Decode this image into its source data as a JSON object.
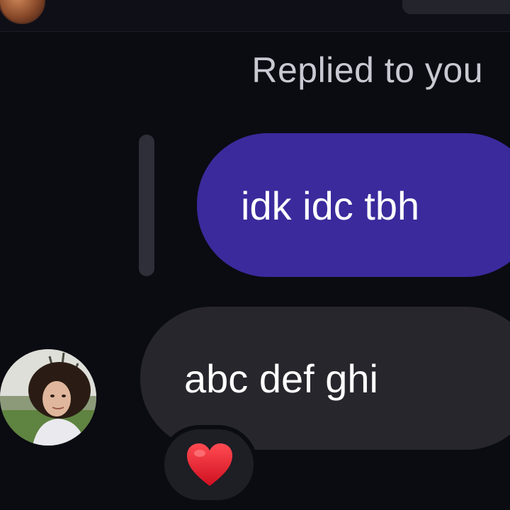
{
  "header": {
    "avatar_icon": "profile-avatar-icon"
  },
  "thread": {
    "reply_label": "Replied to you",
    "quoted_message": "idk idc tbh",
    "reply_message": "abc def ghi",
    "reaction_icon": "red-heart-icon"
  },
  "colors": {
    "background": "#0b0b12",
    "sent_bubble": "#3a2a9c",
    "received_bubble": "#26262c",
    "reply_bar": "#2f2f39",
    "label_text": "#c9c9d2",
    "heart": "#e8212e"
  }
}
